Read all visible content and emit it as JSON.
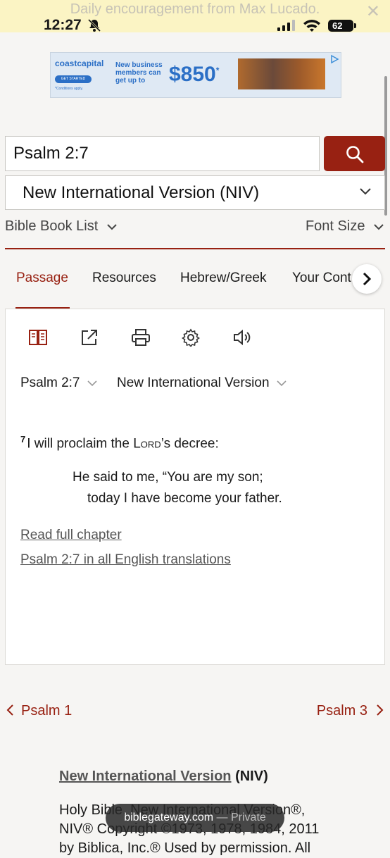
{
  "notification": {
    "text": "Daily encouragement from Max Lucado.",
    "close": "✕"
  },
  "status_bar": {
    "time": "12:27",
    "battery": "62"
  },
  "ad": {
    "brand": "coastcapital",
    "cta": "GET STARTED",
    "fine_print": "*Conditions apply.",
    "headline": "New business members can get up to",
    "amount": "$850",
    "amount_mark": "*"
  },
  "search": {
    "value": "Psalm 2:7"
  },
  "version_select": {
    "value": "New International Version (NIV)"
  },
  "options": {
    "book_list": "Bible Book List",
    "font_size": "Font Size"
  },
  "tabs": [
    {
      "label": "Passage",
      "active": true
    },
    {
      "label": "Resources"
    },
    {
      "label": "Hebrew/Greek"
    },
    {
      "label": "Your Cont"
    }
  ],
  "passage": {
    "reference": "Psalm 2:7",
    "version": "New International Version",
    "verse_number": "7",
    "verse_pre": "I will proclaim the ",
    "verse_lord": "Lord",
    "verse_post": "’s decree:",
    "poem_line1": "He said to me, “You are my son;",
    "poem_line2": "today I have become your father.",
    "read_full": "Read full chapter",
    "all_translations": "Psalm 2:7 in all English translations"
  },
  "navigation": {
    "prev": "Psalm 1",
    "next": "Psalm 3"
  },
  "copyright": {
    "version_link": "New International Version",
    "abbr": "(NIV)",
    "line1": "Holy Bible, New International Version®,",
    "line2": "NIV® Copyright ©1973, 1978, 1984, 2011",
    "line3": "by Biblica, Inc.® Used by permission. All"
  },
  "browser": {
    "domain": "biblegateway.com",
    "mode": "— Private"
  },
  "colors": {
    "accent": "#982112",
    "notification_bg": "#fbf4c4"
  }
}
